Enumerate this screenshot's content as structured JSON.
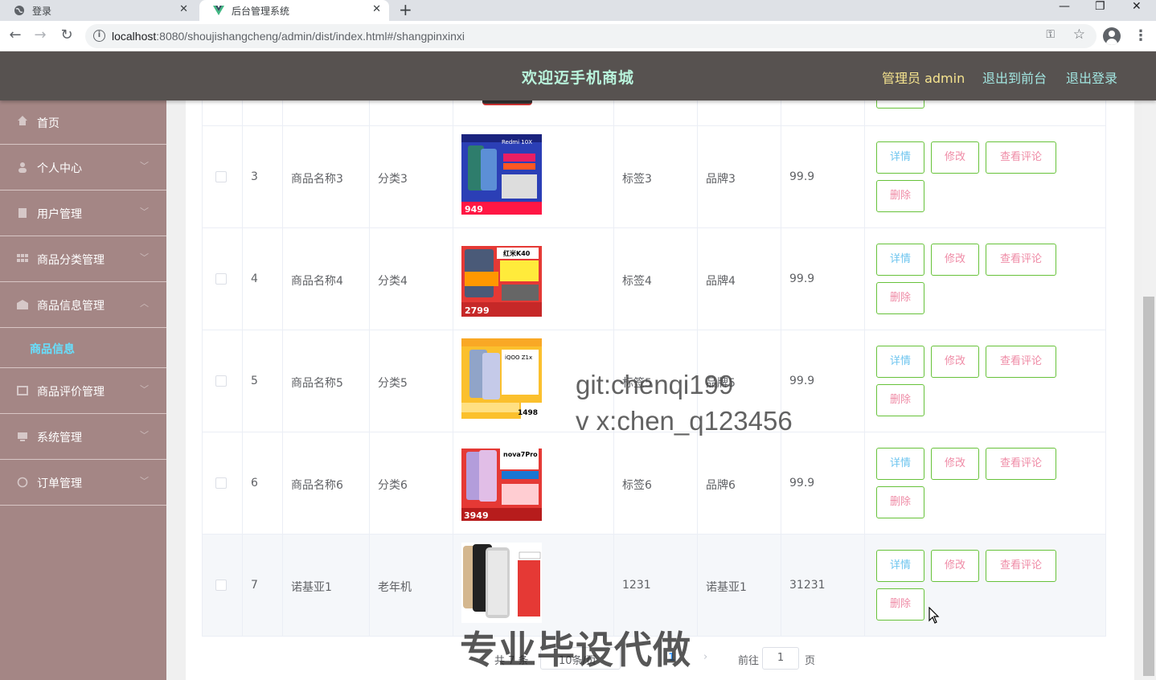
{
  "browser": {
    "tabs": [
      {
        "title": "登录"
      },
      {
        "title": "后台管理系统"
      }
    ],
    "url_host": "localhost",
    "url_rest": ":8080/shoujishangcheng/admin/dist/index.html#/shangpinxinxi"
  },
  "header": {
    "title": "欢迎迈手机商城",
    "admin": "管理员 admin",
    "to_front": "退出到前台",
    "logout": "退出登录"
  },
  "sidebar": {
    "items": [
      {
        "label": "首页",
        "icon": "home-icon"
      },
      {
        "label": "个人中心",
        "icon": "user-icon"
      },
      {
        "label": "用户管理",
        "icon": "document-icon"
      },
      {
        "label": "商品分类管理",
        "icon": "grid-icon"
      },
      {
        "label": "商品信息管理",
        "icon": "goods-icon"
      },
      {
        "label": "商品评价管理",
        "icon": "comment-icon"
      },
      {
        "label": "系统管理",
        "icon": "system-icon"
      },
      {
        "label": "订单管理",
        "icon": "order-icon"
      }
    ],
    "active_sub": "商品信息"
  },
  "table": {
    "rows": [
      {
        "idx": "3",
        "name": "商品名称3",
        "category": "分类3",
        "tag": "标签3",
        "brand": "品牌3",
        "price": "99.9",
        "img_label": "949",
        "img_title": "Redmi 10X"
      },
      {
        "idx": "4",
        "name": "商品名称4",
        "category": "分类4",
        "tag": "标签4",
        "brand": "品牌4",
        "price": "99.9",
        "img_label": "2799",
        "img_title": "红米K40"
      },
      {
        "idx": "5",
        "name": "商品名称5",
        "category": "分类5",
        "tag": "标签5",
        "brand": "品牌5",
        "price": "99.9",
        "img_label": "1498",
        "img_title": "iQOO Z1x"
      },
      {
        "idx": "6",
        "name": "商品名称6",
        "category": "分类6",
        "tag": "标签6",
        "brand": "品牌6",
        "price": "99.9",
        "img_label": "3949",
        "img_title": "nova7Pro"
      },
      {
        "idx": "7",
        "name": "诺基亚1",
        "category": "老年机",
        "tag": "1231",
        "brand": "诺基亚1",
        "price": "31231",
        "img_label": "",
        "img_title": ""
      }
    ],
    "actions": {
      "detail": "详情",
      "edit": "修改",
      "review": "查看评论",
      "delete": "删除"
    }
  },
  "pagination": {
    "total": "共 7 条",
    "page_size": "10条/页",
    "current": "1",
    "goto": "前往",
    "goto_value": "1",
    "page_unit": "页"
  },
  "watermarks": {
    "line1": "git:chenqi199",
    "line2": "v x:chen_q123456",
    "line3": "专业毕设代做"
  },
  "colors": {
    "header_bg": "#575250",
    "sidebar_bg": "#a48685",
    "title": "#b9f4dc",
    "button_border": "#67c23a"
  }
}
